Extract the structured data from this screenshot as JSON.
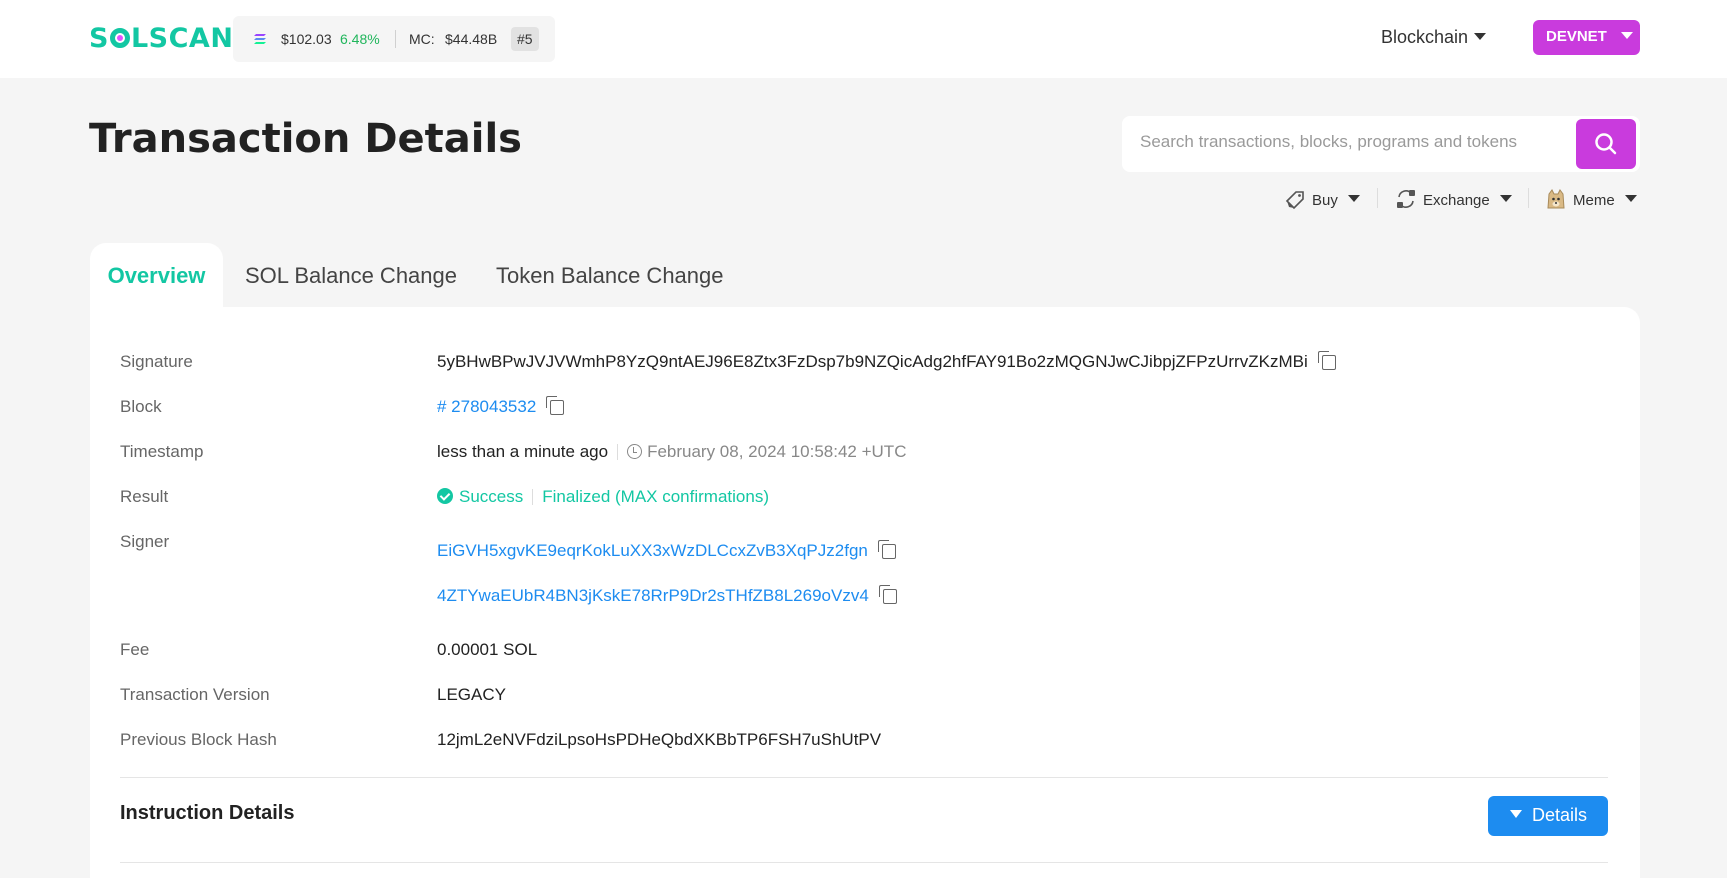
{
  "header": {
    "logo": "SOLSCAN",
    "sol_price": "$102.03",
    "sol_change": "6.48%",
    "mc_label": "MC:",
    "market_cap": "$44.48B",
    "rank": "#5",
    "blockchain_menu": "Blockchain",
    "network": "DEVNET"
  },
  "page": {
    "title": "Transaction Details"
  },
  "search": {
    "placeholder": "Search transactions, blocks, programs and tokens"
  },
  "quick_links": [
    {
      "label": "Buy",
      "icon": "tag-icon"
    },
    {
      "label": "Exchange",
      "icon": "exchange-icon"
    },
    {
      "label": "Meme",
      "icon": "doge-icon"
    }
  ],
  "tabs": [
    {
      "label": "Overview",
      "active": true
    },
    {
      "label": "SOL Balance Change",
      "active": false
    },
    {
      "label": "Token Balance Change",
      "active": false
    }
  ],
  "overview": {
    "signature_label": "Signature",
    "signature": "5yBHwBPwJVJVWmhP8YzQ9ntAEJ96E8Ztx3FzDsp7b9NZQicAdg2hfFAY91Bo2zMQGNJwCJibpjZFPzUrrvZKzMBi",
    "block_label": "Block",
    "block": "# 278043532",
    "timestamp_label": "Timestamp",
    "timestamp_relative": "less than a minute ago",
    "timestamp_absolute": "February 08, 2024 10:58:42 +UTC",
    "result_label": "Result",
    "result_status": "Success",
    "result_confirmation": "Finalized (MAX confirmations)",
    "signer_label": "Signer",
    "signers": [
      "EiGVH5xgvKE9eqrKokLuXX3xWzDLCcxZvB3XqPJz2fgn",
      "4ZTYwaEUbR4BN3jKskE78RrP9Dr2sTHfZB8L269oVzv4"
    ],
    "fee_label": "Fee",
    "fee": "0.00001 SOL",
    "version_label": "Transaction Version",
    "version": "LEGACY",
    "prev_hash_label": "Previous Block Hash",
    "prev_hash": "12jmL2eNVFdziLpsoHsPDHeQbdXKBbTP6FSH7uShUtPV"
  },
  "instructions": {
    "title": "Instruction Details",
    "details_button": "Details"
  },
  "colors": {
    "brand": "#13c7a3",
    "accent": "#c93bdd",
    "link": "#1d8cf0",
    "positive": "#21b65c"
  }
}
